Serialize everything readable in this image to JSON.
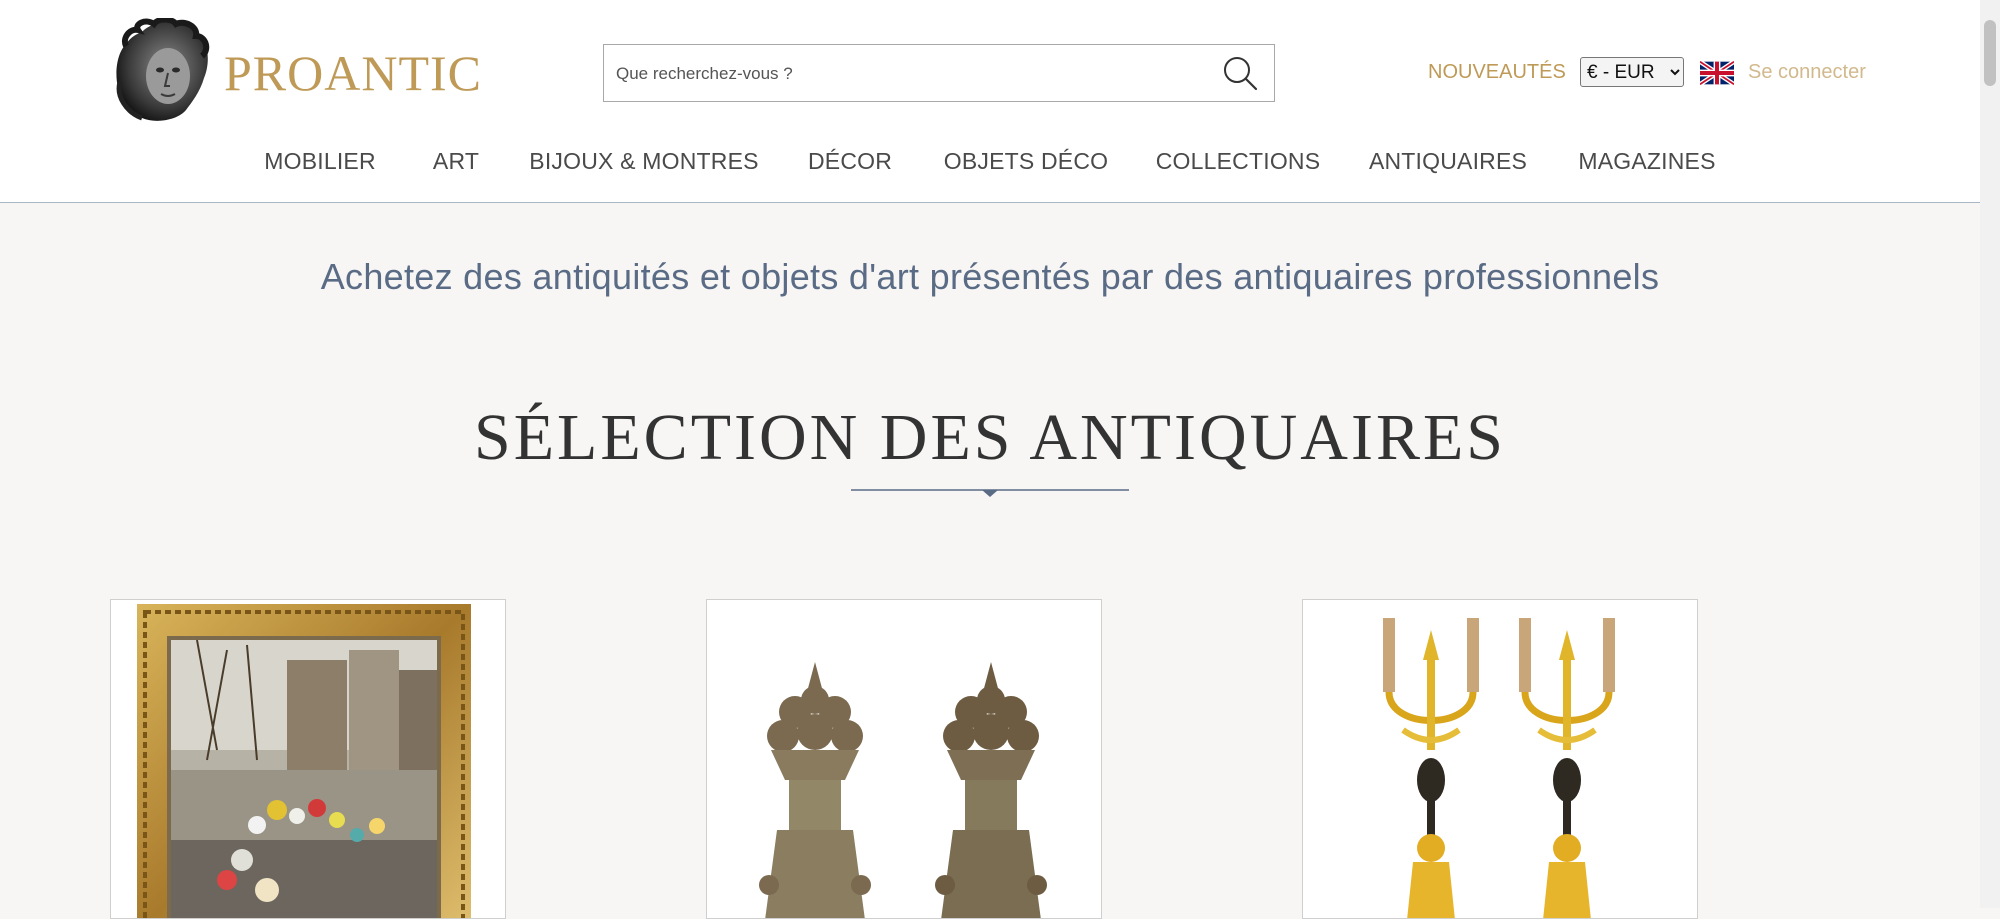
{
  "brand": {
    "name": "PROANTIC"
  },
  "search": {
    "placeholder": "Que recherchez-vous ?"
  },
  "header": {
    "new_label": "NOUVEAUTÉS",
    "currency": {
      "selected": "€ - EUR"
    },
    "language_icon": "uk-flag-icon",
    "login_label": "Se connecter"
  },
  "nav": {
    "items": [
      {
        "label": "MOBILIER"
      },
      {
        "label": "ART"
      },
      {
        "label": "BIJOUX & MONTRES"
      },
      {
        "label": "DÉCOR"
      },
      {
        "label": "OBJETS DÉCO"
      },
      {
        "label": "COLLECTIONS"
      },
      {
        "label": "ANTIQUAIRES"
      },
      {
        "label": "MAGAZINES"
      }
    ]
  },
  "hero": {
    "tagline": "Achetez des antiquités et objets d'art présentés par des antiquaires professionnels"
  },
  "selection": {
    "title": "SÉLECTION DES ANTIQUAIRES",
    "cards": [
      {
        "image": "framed-street-painting"
      },
      {
        "image": "pair-of-fruit-basket-finials"
      },
      {
        "image": "pair-of-gilt-bronze-candelabra"
      }
    ]
  },
  "colors": {
    "brand_gold": "#bf9a57",
    "login_gold": "#d2b98d",
    "tagline_blue": "#5a6b85",
    "divider_blue": "#5a6b85",
    "page_bg": "#f7f6f4"
  }
}
